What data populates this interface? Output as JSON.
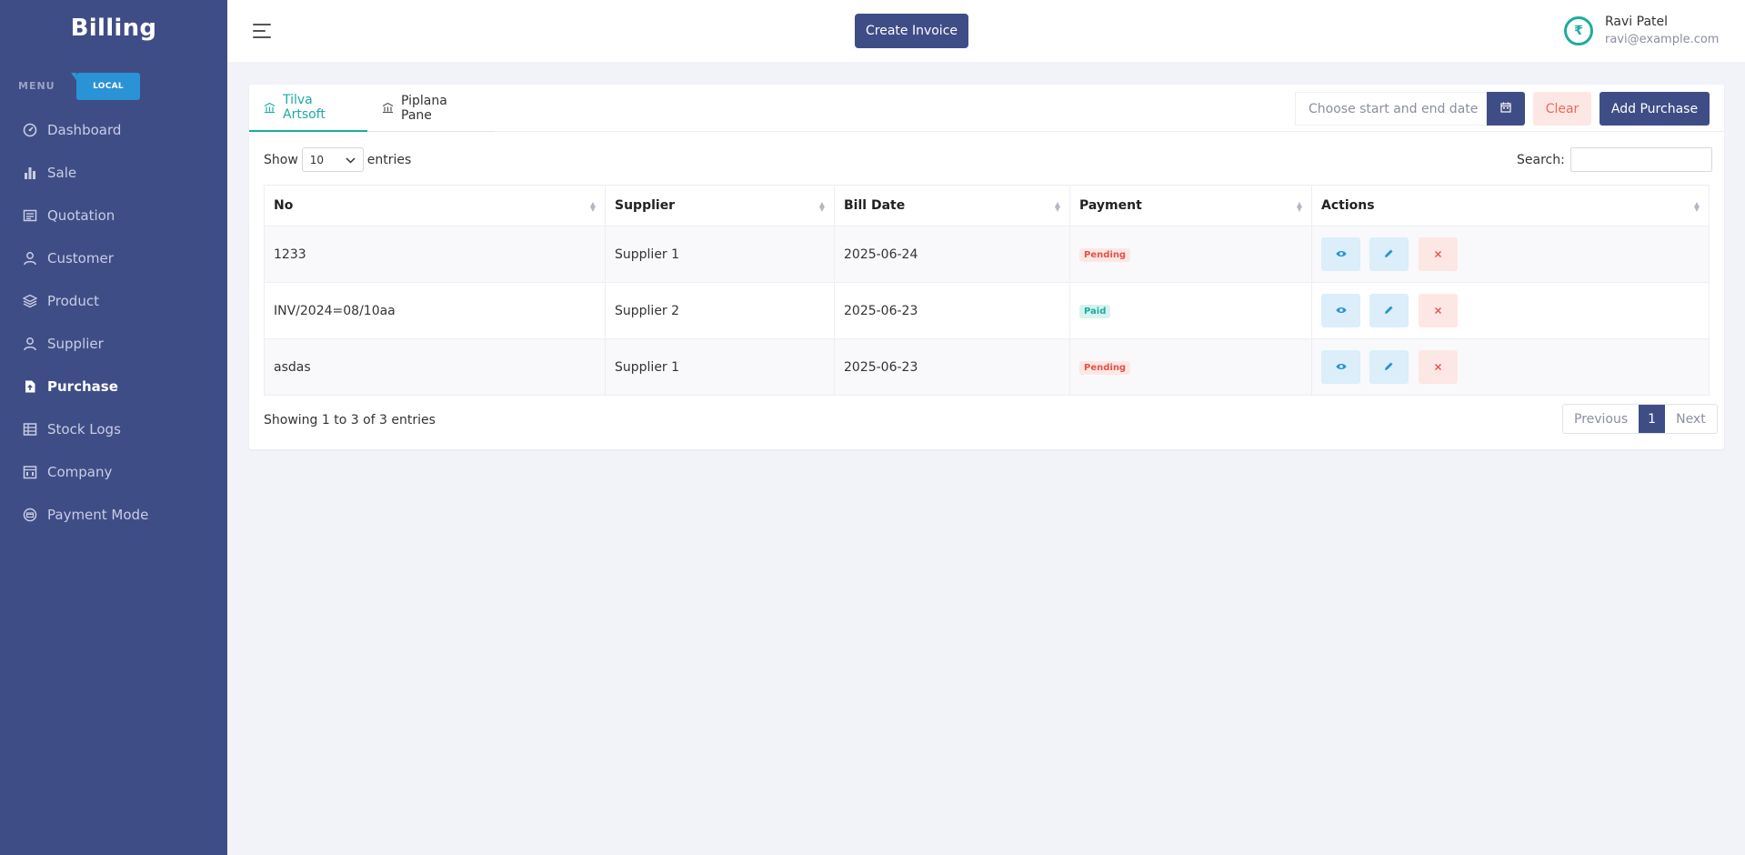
{
  "sidebar": {
    "brand": "Billing",
    "menu_label": "MENU",
    "badge": "LOCAL",
    "items": [
      {
        "label": "Dashboard",
        "icon": "dashboard-icon"
      },
      {
        "label": "Sale",
        "icon": "bar-chart-icon"
      },
      {
        "label": "Quotation",
        "icon": "quotation-icon"
      },
      {
        "label": "Customer",
        "icon": "user-icon"
      },
      {
        "label": "Product",
        "icon": "layers-icon"
      },
      {
        "label": "Supplier",
        "icon": "user-icon"
      },
      {
        "label": "Purchase",
        "icon": "purchase-icon",
        "active": true
      },
      {
        "label": "Stock Logs",
        "icon": "table-icon"
      },
      {
        "label": "Company",
        "icon": "building-icon"
      },
      {
        "label": "Payment Mode",
        "icon": "payment-icon"
      }
    ]
  },
  "topbar": {
    "create_invoice": "Create Invoice",
    "user_initial": "₹",
    "user_name": "Ravi Patel",
    "user_email": "ravi@example.com"
  },
  "card": {
    "tabs": [
      {
        "label": "Tilva Artsoft",
        "active": true
      },
      {
        "label": "Piplana Pane",
        "active": false
      }
    ],
    "date_placeholder": "Choose start and end date",
    "clear_label": "Clear",
    "add_purchase_label": "Add Purchase",
    "show_label": "Show",
    "entries_label": "entries",
    "page_size": "10",
    "search_label": "Search:",
    "columns": [
      "No",
      "Supplier",
      "Bill Date",
      "Payment",
      "Actions"
    ],
    "rows": [
      {
        "no": "1233",
        "supplier": "Supplier 1",
        "bill_date": "2025-06-24",
        "payment": "Pending"
      },
      {
        "no": "INV/2024=08/10aa",
        "supplier": "Supplier 2",
        "bill_date": "2025-06-23",
        "payment": "Paid"
      },
      {
        "no": "asdas",
        "supplier": "Supplier 1",
        "bill_date": "2025-06-23",
        "payment": "Pending"
      }
    ],
    "showing_text": "Showing 1 to 3 of 3 entries",
    "pagination": {
      "previous": "Previous",
      "current": "1",
      "next": "Next"
    }
  },
  "colors": {
    "sidebar_bg": "#3f4d87",
    "accent_teal": "#1dab9e",
    "badge_blue": "#2a93d5",
    "danger": "#e3534a"
  }
}
